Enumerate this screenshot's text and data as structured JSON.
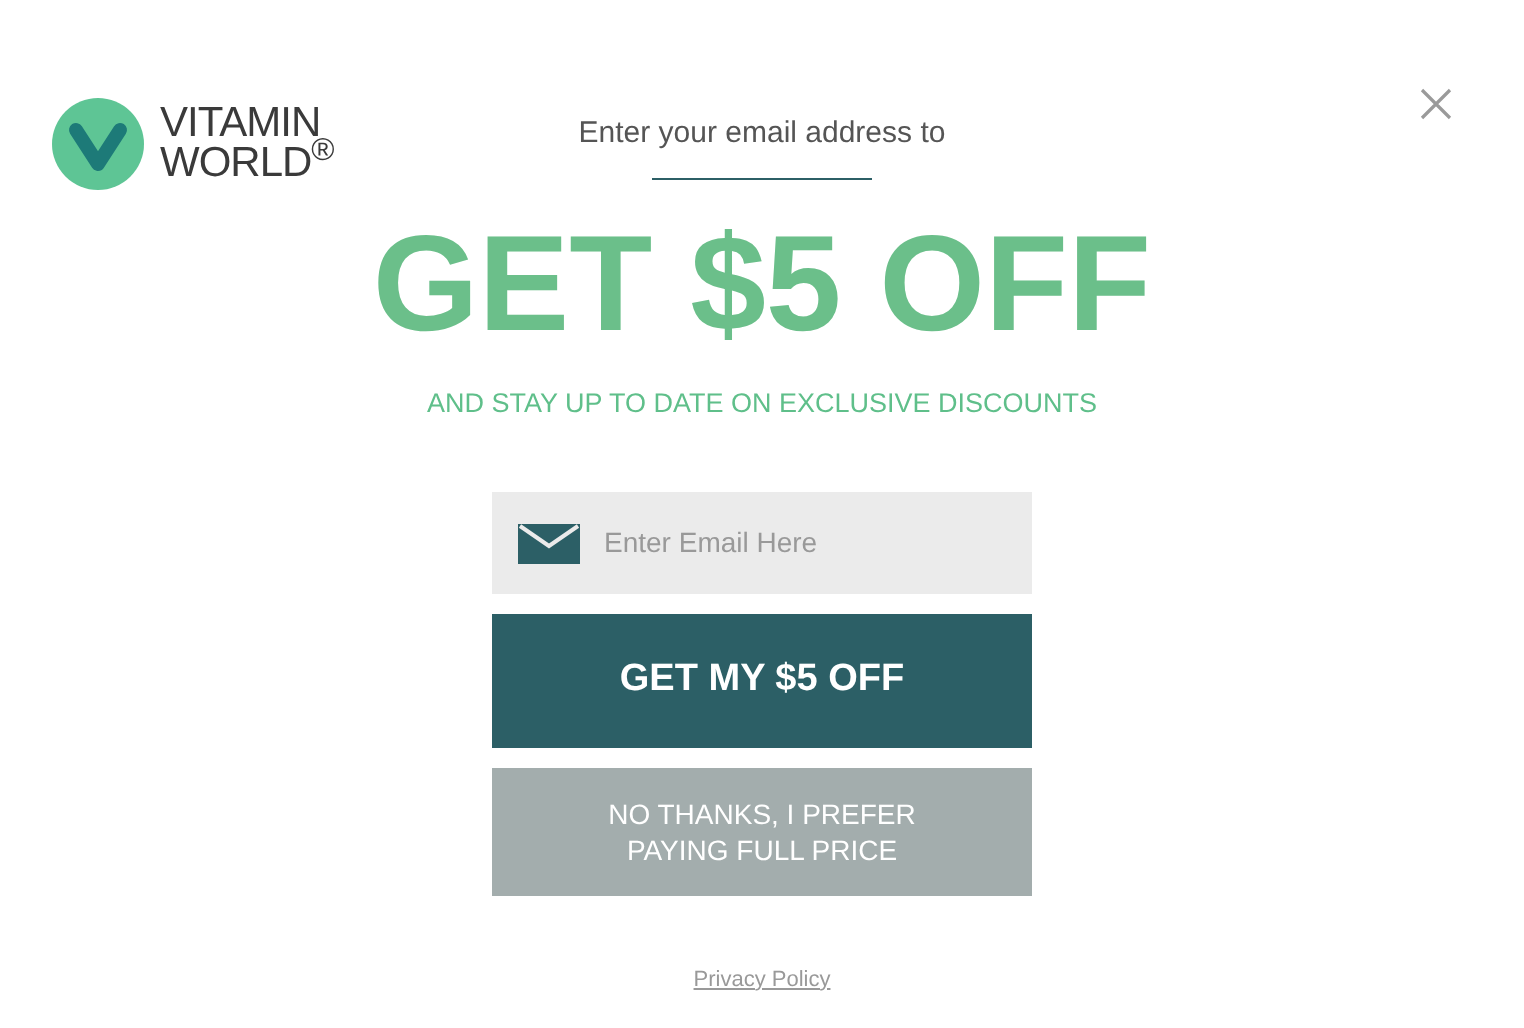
{
  "logo": {
    "line_1": "VITAMIN",
    "line_2": "WORLD$^{®}$"
  },
  "intro": "Enter your email address to",
  "headline": "GET $5 OFF",
  "subheadline": "AND STAY UP TO DATE ON EXCLUSIVE DISCOUNTS",
  "email_field": {
    "placeholder": "Enter Email Here"
  },
  "submit_button": "GET MY $5 OFF",
  "decline_button": {
    "line_1": "NO THANKS, I PREFER",
    "line_2": "PAYING FULL PRICE"
  },
  "privacy_link": "Privacy Policy"
}
